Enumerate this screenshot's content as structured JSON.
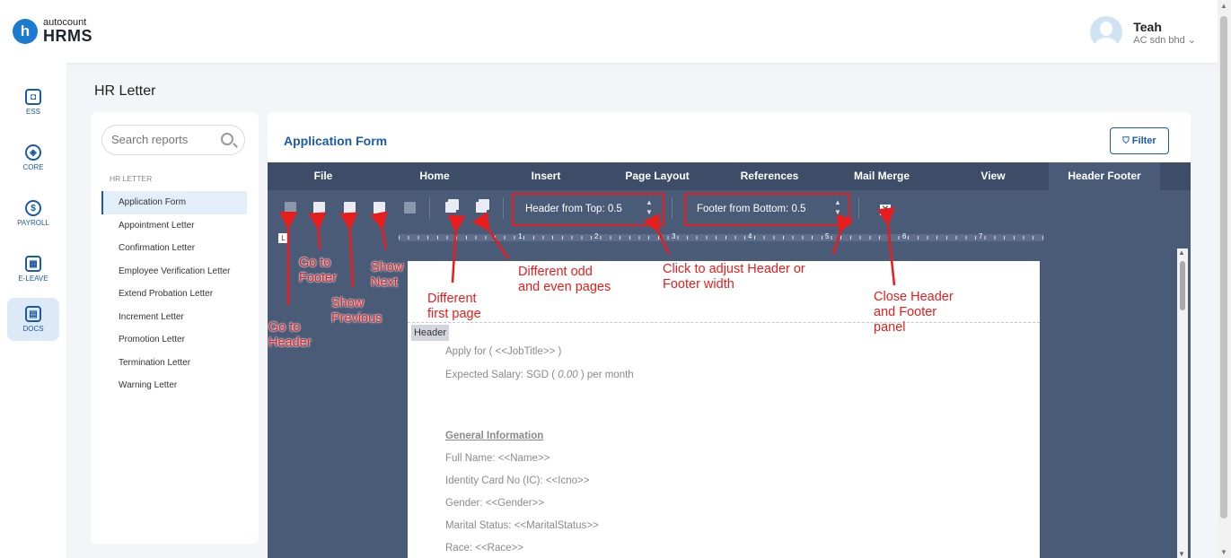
{
  "app": {
    "logo_top": "autocount",
    "logo_bottom": "HRMS",
    "logo_letter": "h"
  },
  "user": {
    "name": "Teah",
    "company": "AC sdn bhd"
  },
  "nav": [
    {
      "label": "ESS",
      "icon": "ess-icon"
    },
    {
      "label": "CORE",
      "icon": "core-icon"
    },
    {
      "label": "PAYROLL",
      "icon": "payroll-icon"
    },
    {
      "label": "E-LEAVE",
      "icon": "calendar-icon"
    },
    {
      "label": "DOCS",
      "icon": "docs-icon"
    }
  ],
  "page_title": "HR Letter",
  "search": {
    "placeholder": "Search reports"
  },
  "section_label": "HR LETTER",
  "reports": [
    "Application Form",
    "Appointment Letter",
    "Confirmation Letter",
    "Employee Verification Letter",
    "Extend Probation Letter",
    "Increment Letter",
    "Promotion Letter",
    "Termination Letter",
    "Warning Letter"
  ],
  "main": {
    "title": "Application Form",
    "filter_label": "Filter"
  },
  "tabs": [
    "File",
    "Home",
    "Insert",
    "Page Layout",
    "References",
    "Mail Merge",
    "View",
    "Header Footer"
  ],
  "toolbar": {
    "header_from_top_label": "Header from Top: 0.5",
    "footer_from_bottom_label": "Footer from Bottom: 0.5"
  },
  "ruler_numbers": [
    "1",
    "2",
    "3",
    "4",
    "5",
    "6",
    "7"
  ],
  "ruler_corner": "L",
  "document": {
    "header_tag": "Header",
    "lines": {
      "apply_for": "Apply for ( <<JobTitle>> )",
      "salary_prefix": "Expected Salary: SGD (",
      "salary_value": "0.00",
      "salary_suffix": ") per month",
      "general_info": "General Information",
      "full_name": "Full Name: <<Name>>",
      "ic": "Identity Card No (IC): <<Icno>>",
      "gender": "Gender: <<Gender>>",
      "marital": "Marital Status: <<MaritalStatus>>",
      "race": "Race: <<Race>>"
    }
  },
  "annotations": {
    "go_to_header": "Go to Header",
    "go_to_footer": "Go to Footer",
    "show_previous": "Show Previous",
    "show_next": "Show Next",
    "different_first_page": "Different first page",
    "different_odd_even": "Different odd and even pages",
    "click_adjust": "Click to adjust Header or Footer width",
    "close_panel": "Close Header and Footer panel"
  },
  "colors": {
    "accent": "#1a5aa8",
    "editor_bg": "#4a5b78",
    "annotation": "#e81c1c"
  }
}
